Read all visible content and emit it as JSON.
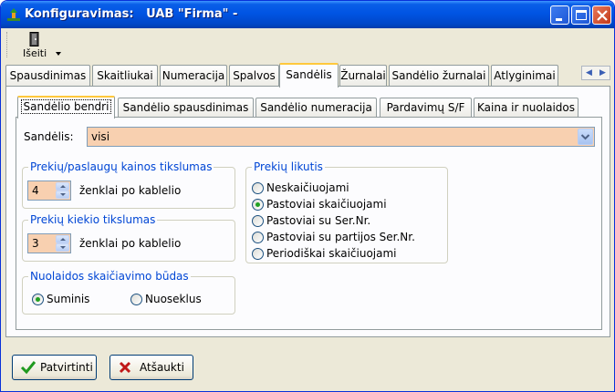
{
  "window": {
    "title": "Konfiguravimas:   UAB \"Firma\" -"
  },
  "toolbar": {
    "exit_label": "Išeiti"
  },
  "main_tabs": [
    {
      "label": "Spausdinimas"
    },
    {
      "label": "Skaitliukai"
    },
    {
      "label": "Numeracija"
    },
    {
      "label": "Spalvos"
    },
    {
      "label": "Sandėlis"
    },
    {
      "label": "Žurnalai"
    },
    {
      "label": "Sandėlio žurnalai"
    },
    {
      "label": "Atlyginimai"
    }
  ],
  "sub_tabs": [
    {
      "label": "Sandėlio bendri"
    },
    {
      "label": "Sandėlio spausdinimas"
    },
    {
      "label": "Sandėlio numeracija"
    },
    {
      "label": "Pardavimų S/F"
    },
    {
      "label": "Kaina ir nuolaidos"
    }
  ],
  "warehouse": {
    "label": "Sandėlis:",
    "value": "visi"
  },
  "price_precision": {
    "title": "Prekių/paslaugų kainos tikslumas",
    "value": "4",
    "suffix": "ženklai po kablelio"
  },
  "quantity_precision": {
    "title": "Prekių kiekio tikslumas",
    "value": "3",
    "suffix": "ženklai po kablelio"
  },
  "discount_method": {
    "title": "Nuolaidos skaičiavimo būdas",
    "options": [
      {
        "label": "Suminis"
      },
      {
        "label": "Nuoseklus"
      }
    ],
    "selected": "Suminis"
  },
  "stock_balance": {
    "title": "Prekių likutis",
    "options": [
      {
        "label": "Neskaičiuojami"
      },
      {
        "label": "Pastoviai skaičiuojami"
      },
      {
        "label": "Pastoviai su Ser.Nr."
      },
      {
        "label": "Pastoviai su partijos Ser.Nr."
      },
      {
        "label": "Periodiškai skaičiuojami"
      }
    ],
    "selected": "Pastoviai skaičiuojami"
  },
  "buttons": {
    "confirm": "Patvirtinti",
    "cancel": "Atšaukti"
  },
  "colors": {
    "titlebar": "#0054e3",
    "group_title": "#0046d5",
    "input_background": "#f8d0b0",
    "active_tab_accent": "#ffc83c",
    "window_background": "#ece9d8"
  }
}
